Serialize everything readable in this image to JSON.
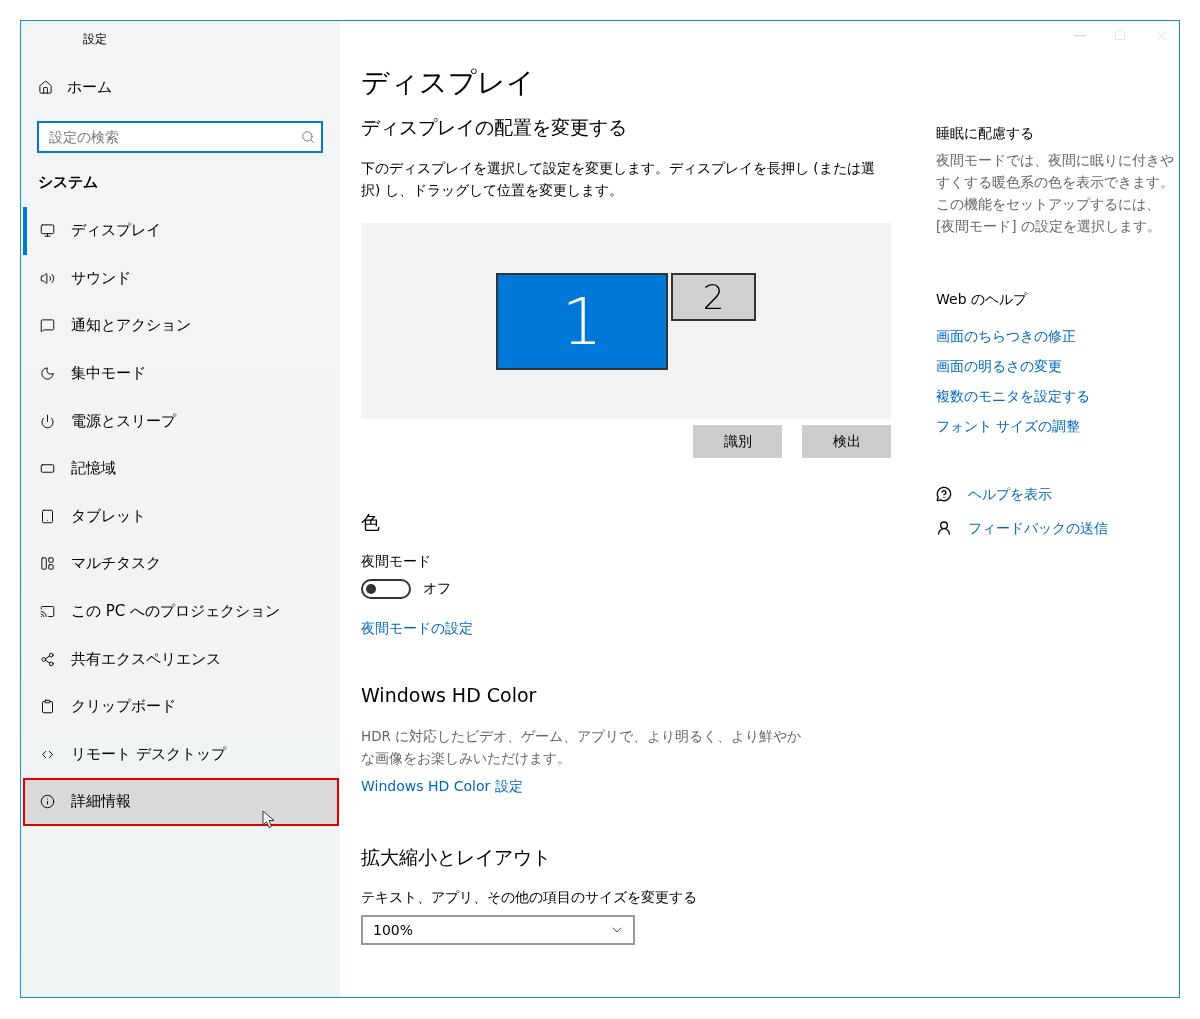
{
  "window": {
    "title": "設定"
  },
  "sidebar": {
    "home": "ホーム",
    "search": {
      "placeholder": "設定の検索"
    },
    "section": "システム",
    "items": [
      {
        "label": "ディスプレイ",
        "selected": true,
        "hovered": false,
        "outlined": false
      },
      {
        "label": "サウンド",
        "selected": false,
        "hovered": false,
        "outlined": false
      },
      {
        "label": "通知とアクション",
        "selected": false,
        "hovered": false,
        "outlined": false
      },
      {
        "label": "集中モード",
        "selected": false,
        "hovered": false,
        "outlined": false
      },
      {
        "label": "電源とスリープ",
        "selected": false,
        "hovered": false,
        "outlined": false
      },
      {
        "label": "記憶域",
        "selected": false,
        "hovered": false,
        "outlined": false
      },
      {
        "label": "タブレット",
        "selected": false,
        "hovered": false,
        "outlined": false
      },
      {
        "label": "マルチタスク",
        "selected": false,
        "hovered": false,
        "outlined": false
      },
      {
        "label": "この PC へのプロジェクション",
        "selected": false,
        "hovered": false,
        "outlined": false
      },
      {
        "label": "共有エクスペリエンス",
        "selected": false,
        "hovered": false,
        "outlined": false
      },
      {
        "label": "クリップボード",
        "selected": false,
        "hovered": false,
        "outlined": false
      },
      {
        "label": "リモート デスクトップ",
        "selected": false,
        "hovered": false,
        "outlined": false
      },
      {
        "label": "詳細情報",
        "selected": false,
        "hovered": true,
        "outlined": true
      }
    ]
  },
  "main": {
    "title": "ディスプレイ",
    "arrangement": {
      "heading": "ディスプレイの配置を変更する",
      "description": "下のディスプレイを選択して設定を変更します。ディスプレイを長押し (または選択) し、ドラッグして位置を変更します。",
      "monitors": [
        {
          "label": "1",
          "selected": true
        },
        {
          "label": "2",
          "selected": false
        }
      ],
      "buttons": [
        "識別",
        "検出"
      ]
    },
    "color": {
      "heading": "色",
      "night_light": {
        "label": "夜間モード",
        "on": false,
        "state_text": "オフ"
      },
      "link": "夜間モードの設定"
    },
    "hdr": {
      "heading": "Windows HD Color",
      "description": "HDR に対応したビデオ、ゲーム、アプリで、より明るく、より鮮やかな画像をお楽しみいただけます。",
      "link": "Windows HD Color 設定"
    },
    "scale": {
      "heading": "拡大縮小とレイアウト",
      "label": "テキスト、アプリ、その他の項目のサイズを変更する",
      "value": "100%"
    }
  },
  "aside": {
    "sleep": {
      "heading": "睡眠に配慮する",
      "text": "夜間モードでは、夜間に眠りに付きやすくする暖色系の色を表示できます。この機能をセットアップするには、[夜間モード] の設定を選択します。"
    },
    "web_help": {
      "heading": "Web のヘルプ",
      "links": [
        "画面のちらつきの修正",
        "画面の明るさの変更",
        "複数のモニタを設定する",
        "フォント サイズの調整"
      ]
    },
    "actions": [
      "ヘルプを表示",
      "フィードバックの送信"
    ]
  }
}
